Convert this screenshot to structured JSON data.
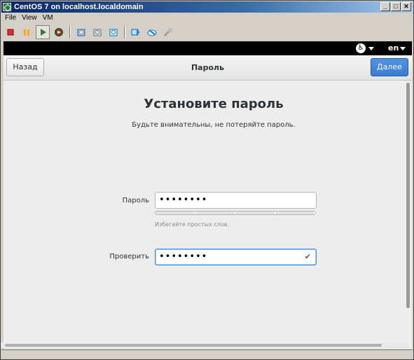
{
  "window": {
    "title": "CentOS 7 on localhost.localdomain",
    "controls": [
      "_",
      "□",
      "✕"
    ]
  },
  "menu": {
    "file": "File",
    "view": "View",
    "vm": "VM"
  },
  "toolbar": {
    "icons": [
      "stop-icon",
      "pause-icon",
      "play-icon",
      "reset-icon",
      "snapshot-icon",
      "revert-icon",
      "snapshot-manager-icon",
      "send-keys-icon",
      "settings-icon",
      "tools-icon"
    ]
  },
  "guest_topbar": {
    "accessibility_symbol": "♿",
    "language": "en"
  },
  "header": {
    "back_label": "Назад",
    "title": "Пароль",
    "next_label": "Далее",
    "accent_color": "#3a7bd5"
  },
  "main": {
    "heading": "Установите пароль",
    "subheading": "Будьте внимательны, не потеряйте пароль.",
    "password_label": "Пароль",
    "password_value": "••••••••",
    "strength_hint": "Избегайте простых слов.",
    "verify_label": "Проверить",
    "verify_value": "••••••••",
    "verify_check": "✔"
  }
}
